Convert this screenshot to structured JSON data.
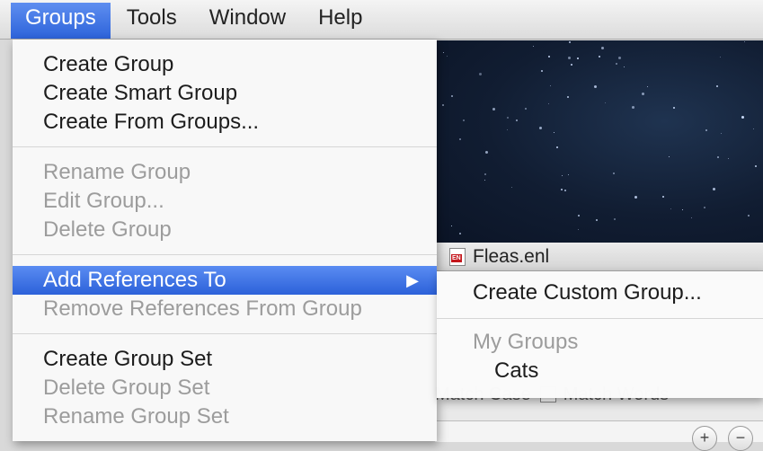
{
  "menubar": {
    "items": [
      "Groups",
      "Tools",
      "Window",
      "Help"
    ]
  },
  "groups_menu": {
    "sections": [
      [
        {
          "label": "Create Group",
          "enabled": true
        },
        {
          "label": "Create Smart Group",
          "enabled": true
        },
        {
          "label": "Create From Groups...",
          "enabled": true
        }
      ],
      [
        {
          "label": "Rename Group",
          "enabled": false
        },
        {
          "label": "Edit Group...",
          "enabled": false
        },
        {
          "label": "Delete Group",
          "enabled": false
        }
      ],
      [
        {
          "label": "Add References To",
          "enabled": true,
          "highlighted": true,
          "submenu": true
        },
        {
          "label": "Remove References From Group",
          "enabled": false
        }
      ],
      [
        {
          "label": "Create Group Set",
          "enabled": true
        },
        {
          "label": "Delete Group Set",
          "enabled": false
        },
        {
          "label": "Rename Group Set",
          "enabled": false
        }
      ]
    ]
  },
  "submenu": {
    "create_custom_label": "Create Custom Group...",
    "section_header": "My Groups",
    "groups": [
      "Cats"
    ]
  },
  "background_window": {
    "file_name": "Fleas.enl",
    "file_badge": "EN",
    "search_options_text": "Match Case",
    "search_options_text_2": "Match Words",
    "plus_button": "+",
    "minus_button": "−"
  },
  "colors": {
    "highlight": "#3a6fe2",
    "menu_bg": "#f8f8f8",
    "disabled_text": "#9c9c9c",
    "starfield": "#111d32"
  },
  "icons": {
    "submenu_arrow": "triangle-right-icon",
    "file": "endnote-library-icon"
  }
}
